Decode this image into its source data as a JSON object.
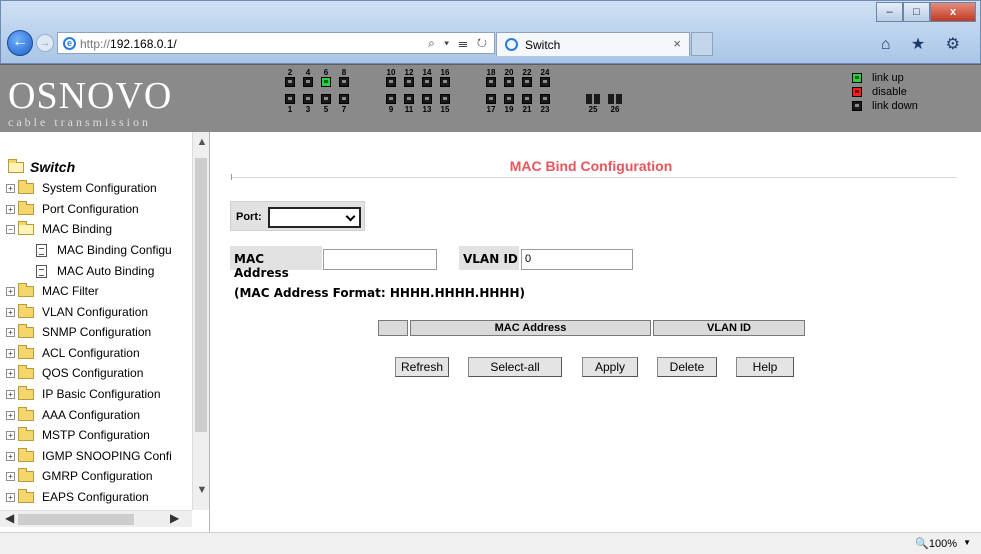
{
  "browser": {
    "url_protocol": "http://",
    "url_host": "192.168.0.1/",
    "address_controls": "⌕ ▾ ☰ ↻",
    "tab_title": "Switch",
    "tab_close": "×",
    "toolbar_icons": "⌂ ★ ⚙",
    "window_buttons": {
      "minimize": "–",
      "maximize": "□",
      "close": "x"
    },
    "back": "←",
    "forward": "→"
  },
  "header": {
    "brand": "OSNOVO",
    "tagline": "cable transmission",
    "top_port_numbers": [
      "2",
      "4",
      "6",
      "8",
      "10",
      "12",
      "14",
      "16",
      "18",
      "20",
      "22",
      "24"
    ],
    "bottom_port_numbers": [
      "1",
      "3",
      "5",
      "7",
      "9",
      "11",
      "13",
      "15",
      "17",
      "19",
      "21",
      "23",
      "25",
      "26"
    ],
    "port_status_up": [
      6
    ],
    "legend": [
      {
        "label": "link up",
        "color": "#2ecc40"
      },
      {
        "label": "disable",
        "color": "#ff1a1a"
      },
      {
        "label": "link down",
        "color": "#1a1a1a"
      }
    ]
  },
  "sidebar": {
    "root": "Switch",
    "items": [
      {
        "label": "System Configuration",
        "expander": "+"
      },
      {
        "label": "Port Configuration",
        "expander": "+"
      },
      {
        "label": "MAC Binding",
        "expander": "−"
      },
      {
        "label": "MAC Filter",
        "expander": "+"
      },
      {
        "label": "VLAN Configuration",
        "expander": "+"
      },
      {
        "label": "SNMP Configuration",
        "expander": "+"
      },
      {
        "label": "ACL Configuration",
        "expander": "+"
      },
      {
        "label": "QOS Configuration",
        "expander": "+"
      },
      {
        "label": "IP Basic Configuration",
        "expander": "+"
      },
      {
        "label": "AAA Configuration",
        "expander": "+"
      },
      {
        "label": "MSTP Configuration",
        "expander": "+"
      },
      {
        "label": "IGMP SNOOPING Confi",
        "expander": "+"
      },
      {
        "label": "GMRP Configuration",
        "expander": "+"
      },
      {
        "label": "EAPS Configuration",
        "expander": "+"
      }
    ],
    "subitems": [
      {
        "label": "MAC Binding Configu"
      },
      {
        "label": "MAC Auto Binding"
      }
    ]
  },
  "main": {
    "title": "MAC Bind Configuration",
    "port_label": "Port:",
    "port_value": "",
    "mac_label": "MAC Address",
    "mac_value": "",
    "vlan_label": "VLAN ID",
    "vlan_value": "0",
    "format_note": "(MAC Address Format: HHHH.HHHH.HHHH)",
    "table_columns": [
      "",
      "MAC Address",
      "VLAN ID"
    ],
    "buttons": [
      "Refresh",
      "Select-all",
      "Apply",
      "Delete",
      "Help"
    ]
  },
  "status": {
    "zoom": "🔍100%",
    "zoom_caret": "▼"
  },
  "colors": {
    "title": "#e8555c",
    "header_bg": "#8a8a8a"
  }
}
